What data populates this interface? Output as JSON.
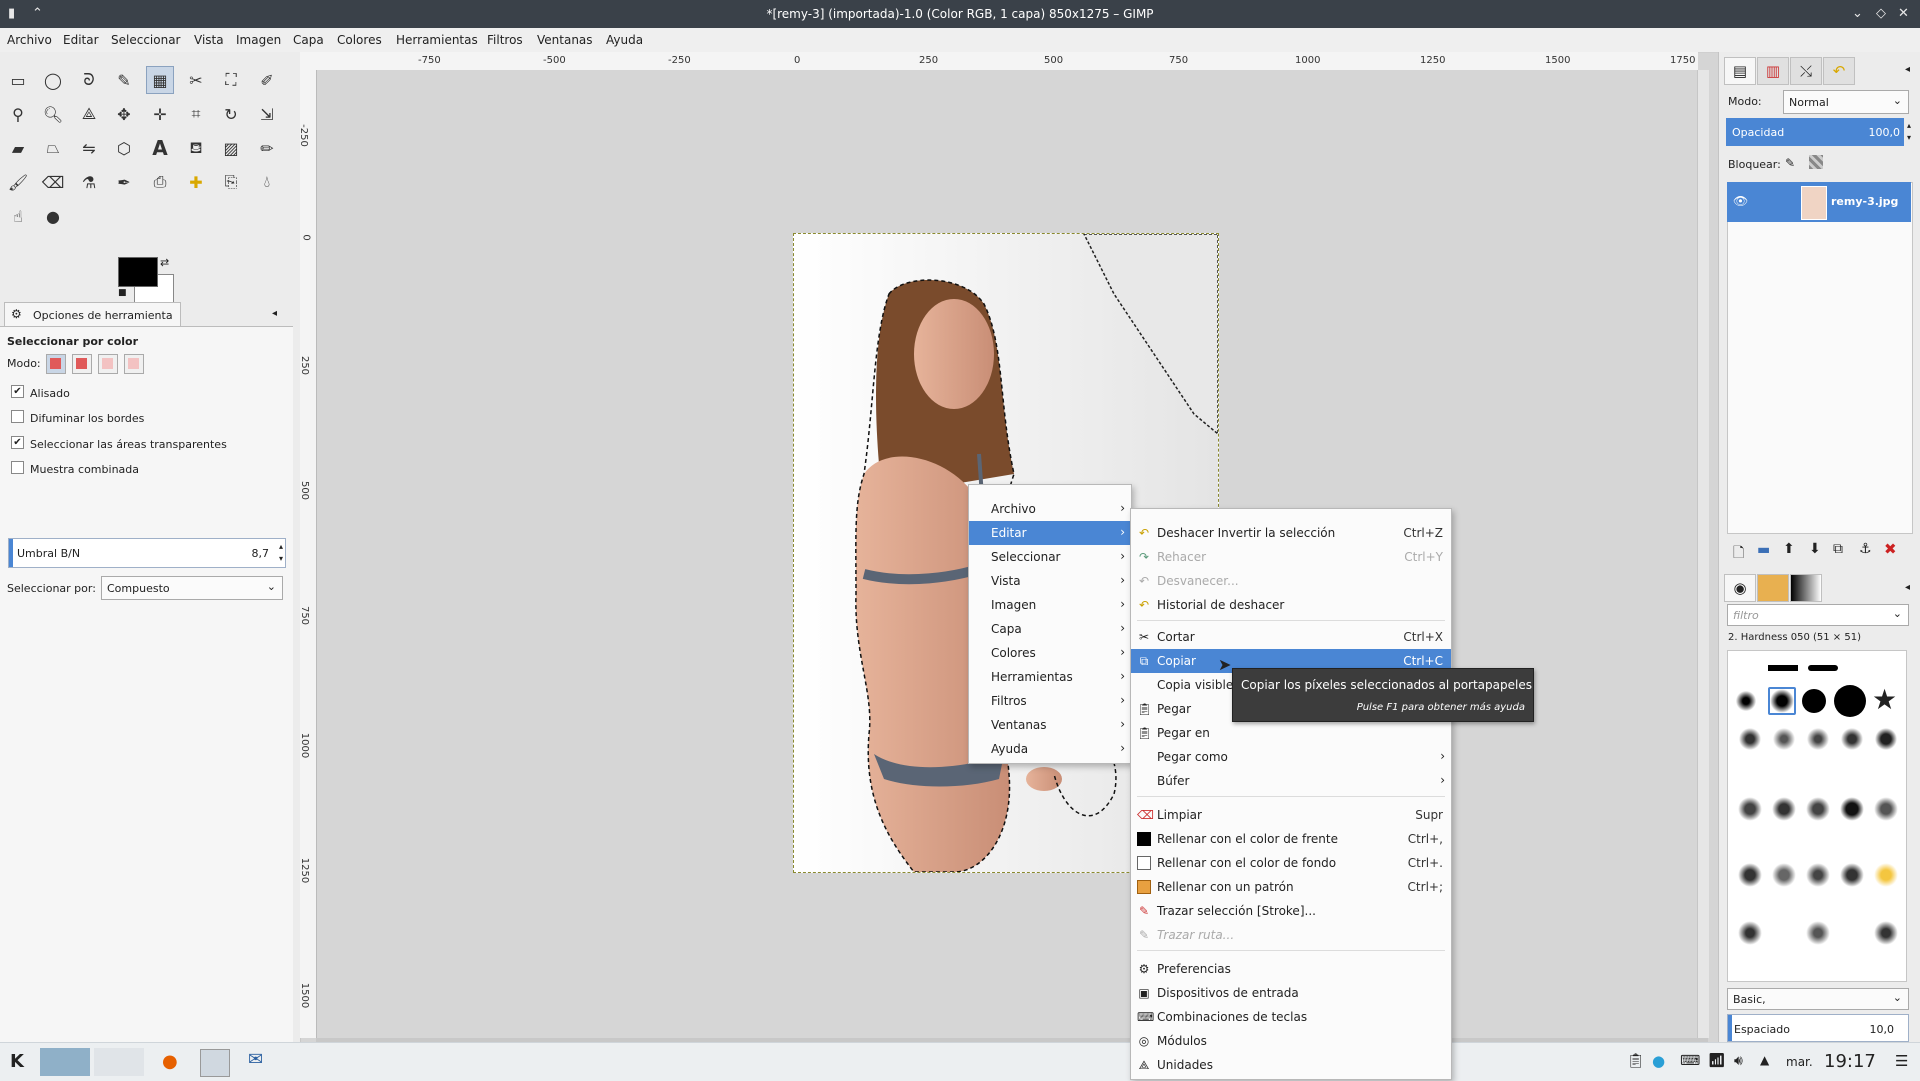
{
  "window": {
    "title": "*[remy-3] (importada)-1.0 (Color RGB, 1 capa) 850x1275 – GIMP"
  },
  "menubar": [
    "Archivo",
    "Editar",
    "Seleccionar",
    "Vista",
    "Imagen",
    "Capa",
    "Colores",
    "Herramientas",
    "Filtros",
    "Ventanas",
    "Ayuda"
  ],
  "ruler": {
    "h": [
      "-750",
      "-500",
      "-250",
      "0",
      "250",
      "500",
      "750",
      "1000",
      "1250",
      "1500",
      "1750"
    ],
    "v": [
      "-250",
      "0",
      "250",
      "500",
      "750",
      "1000",
      "1250",
      "1500"
    ]
  },
  "tool_options": {
    "tab_label": "Opciones de herramienta",
    "tool_name": "Seleccionar por color",
    "mode_label": "Modo:",
    "antialias": {
      "label": "Alisado",
      "checked": true
    },
    "feather": {
      "label": "Difuminar los bordes",
      "checked": false
    },
    "transparent": {
      "label": "Seleccionar las áreas transparentes",
      "checked": true
    },
    "merged": {
      "label": "Muestra combinada",
      "checked": false
    },
    "threshold": {
      "label": "Umbral B/N",
      "value": "8,7"
    },
    "select_by": {
      "label": "Seleccionar por:",
      "value": "Compuesto"
    }
  },
  "layers": {
    "mode_label": "Modo:",
    "mode_value": "Normal",
    "opacity_label": "Opacidad",
    "opacity_value": "100,0",
    "lock_label": "Bloquear:",
    "layer_name": "remy-3.jpg"
  },
  "brushes": {
    "filter_placeholder": "filtro",
    "current": "2. Hardness 050 (51 × 51)",
    "tag": "Basic,",
    "spacing_label": "Espaciado",
    "spacing_value": "10,0"
  },
  "context_menu": {
    "items": [
      "Archivo",
      "Editar",
      "Seleccionar",
      "Vista",
      "Imagen",
      "Capa",
      "Colores",
      "Herramientas",
      "Filtros",
      "Ventanas",
      "Ayuda"
    ]
  },
  "edit_menu": {
    "items": [
      {
        "label": "Deshacer Invertir la selección",
        "shortcut": "Ctrl+Z"
      },
      {
        "label": "Rehacer",
        "shortcut": "Ctrl+Y"
      },
      {
        "label": "Desvanecer...",
        "shortcut": ""
      },
      {
        "label": "Historial de deshacer",
        "shortcut": ""
      },
      {
        "label": "Cortar",
        "shortcut": "Ctrl+X"
      },
      {
        "label": "Copiar",
        "shortcut": "Ctrl+C"
      },
      {
        "label": "Copia visible",
        "shortcut": ""
      },
      {
        "label": "Pegar",
        "shortcut": ""
      },
      {
        "label": "Pegar en",
        "shortcut": ""
      },
      {
        "label": "Pegar como",
        "shortcut": ""
      },
      {
        "label": "Búfer",
        "shortcut": ""
      },
      {
        "label": "Limpiar",
        "shortcut": "Supr"
      },
      {
        "label": "Rellenar con el color de frente",
        "shortcut": "Ctrl+,"
      },
      {
        "label": "Rellenar con el color de fondo",
        "shortcut": "Ctrl+."
      },
      {
        "label": "Rellenar con un patrón",
        "shortcut": "Ctrl+;"
      },
      {
        "label": "Trazar selección [Stroke]...",
        "shortcut": ""
      },
      {
        "label": "Trazar ruta...",
        "shortcut": ""
      },
      {
        "label": "Preferencias",
        "shortcut": ""
      },
      {
        "label": "Dispositivos de entrada",
        "shortcut": ""
      },
      {
        "label": "Combinaciones de teclas",
        "shortcut": ""
      },
      {
        "label": "Módulos",
        "shortcut": ""
      },
      {
        "label": "Unidades",
        "shortcut": ""
      }
    ]
  },
  "tooltip": {
    "text": "Copiar los píxeles seleccionados al portapapeles",
    "hint": "Pulse F1 para obtener más ayuda"
  },
  "taskbar": {
    "day": "mar.",
    "time": "19:17"
  },
  "colors": {
    "accent": "#4a86d4",
    "titlebar": "#3a4149"
  }
}
